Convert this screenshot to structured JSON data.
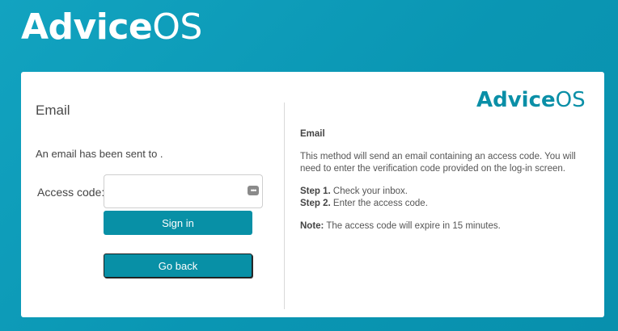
{
  "header": {
    "brand_bold": "Advice",
    "brand_thin": "OS"
  },
  "card": {
    "left": {
      "title": "Email",
      "sent_message": "An email has been sent to .",
      "code_label": "Access code:",
      "code_value": "",
      "code_placeholder": "",
      "signin_label": "Sign in",
      "goback_label": "Go back"
    },
    "right": {
      "logo_bold": "Advice",
      "logo_thin": "OS",
      "heading": "Email",
      "description": "This method will send an email containing an access code. You will need to enter the verification code provided on the log-in screen.",
      "step1_label": "Step 1.",
      "step1_text": " Check your inbox.",
      "step2_label": "Step 2.",
      "step2_text": " Enter the access code.",
      "note_label": "Note:",
      "note_text": " The access code will expire in 15 minutes."
    }
  },
  "icons": {
    "password_manager": "dots-icon"
  },
  "colors": {
    "background": "#0a96b3",
    "accent": "#0890a6",
    "card": "#ffffff"
  }
}
